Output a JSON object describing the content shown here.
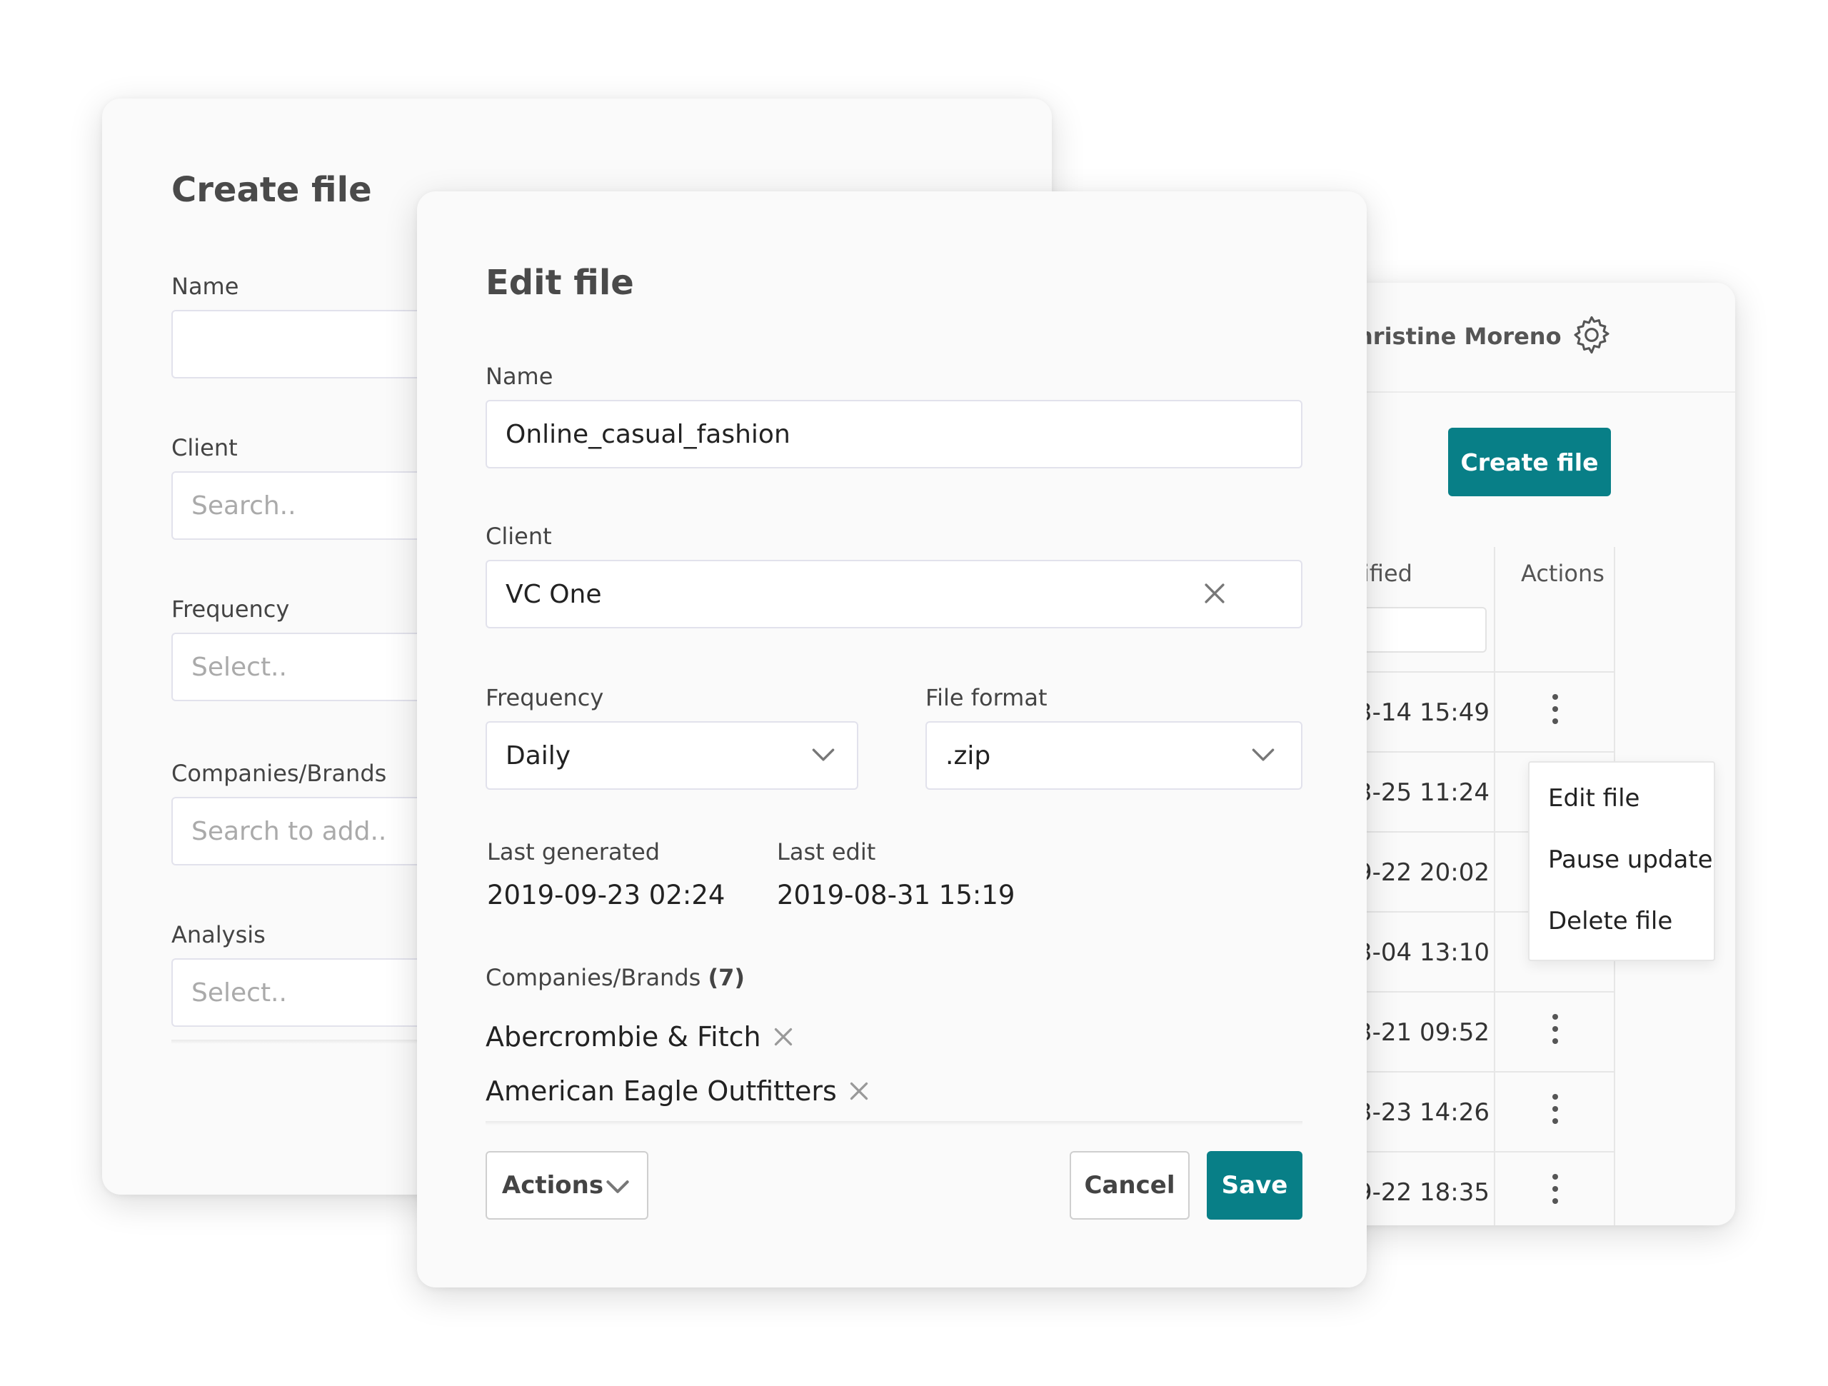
{
  "create_file_dialog": {
    "title": "Create file",
    "fields": {
      "name_label": "Name",
      "client_label": "Client",
      "client_placeholder": "Search..",
      "frequency_label": "Frequency",
      "frequency_placeholder": "Select..",
      "companies_label": "Companies/Brands",
      "companies_placeholder": "Search to add..",
      "analysis_label": "Analysis",
      "analysis_placeholder": "Select.."
    }
  },
  "files_panel": {
    "user_name": "hristine Moreno",
    "create_button": "Create file",
    "columns": {
      "modified": "lified",
      "actions": "Actions"
    },
    "rows": [
      {
        "modified": "3-14 15:49"
      },
      {
        "modified": "3-25 11:24"
      },
      {
        "modified": "9-22 20:02"
      },
      {
        "modified": "3-04 13:10"
      },
      {
        "modified": "3-21 09:52"
      },
      {
        "modified": "3-23 14:26"
      },
      {
        "modified": "9-22 18:35"
      }
    ],
    "context_menu": [
      "Edit file",
      "Pause update",
      "Delete file"
    ]
  },
  "edit_file_dialog": {
    "title": "Edit file",
    "name_label": "Name",
    "name_value": "Online_casual_fashion",
    "client_label": "Client",
    "client_value": "VC One",
    "frequency_label": "Frequency",
    "frequency_value": "Daily",
    "file_format_label": "File format",
    "file_format_value": ".zip",
    "last_generated_label": "Last generated",
    "last_generated_value": "2019-09-23 02:24",
    "last_edit_label": "Last edit",
    "last_edit_value": "2019-08-31 15:19",
    "companies_label": "Companies/Brands",
    "companies_count": "(7)",
    "companies": [
      "Abercrombie & Fitch",
      "American Eagle Outfitters"
    ],
    "actions_button": "Actions",
    "cancel_button": "Cancel",
    "save_button": "Save"
  },
  "colors": {
    "accent": "#087f87",
    "card_bg": "#fafafa",
    "border": "#e2e2ec"
  },
  "icons": [
    "gear-icon",
    "clear-icon",
    "chevron-down-icon",
    "remove-icon",
    "kebab-icon"
  ]
}
